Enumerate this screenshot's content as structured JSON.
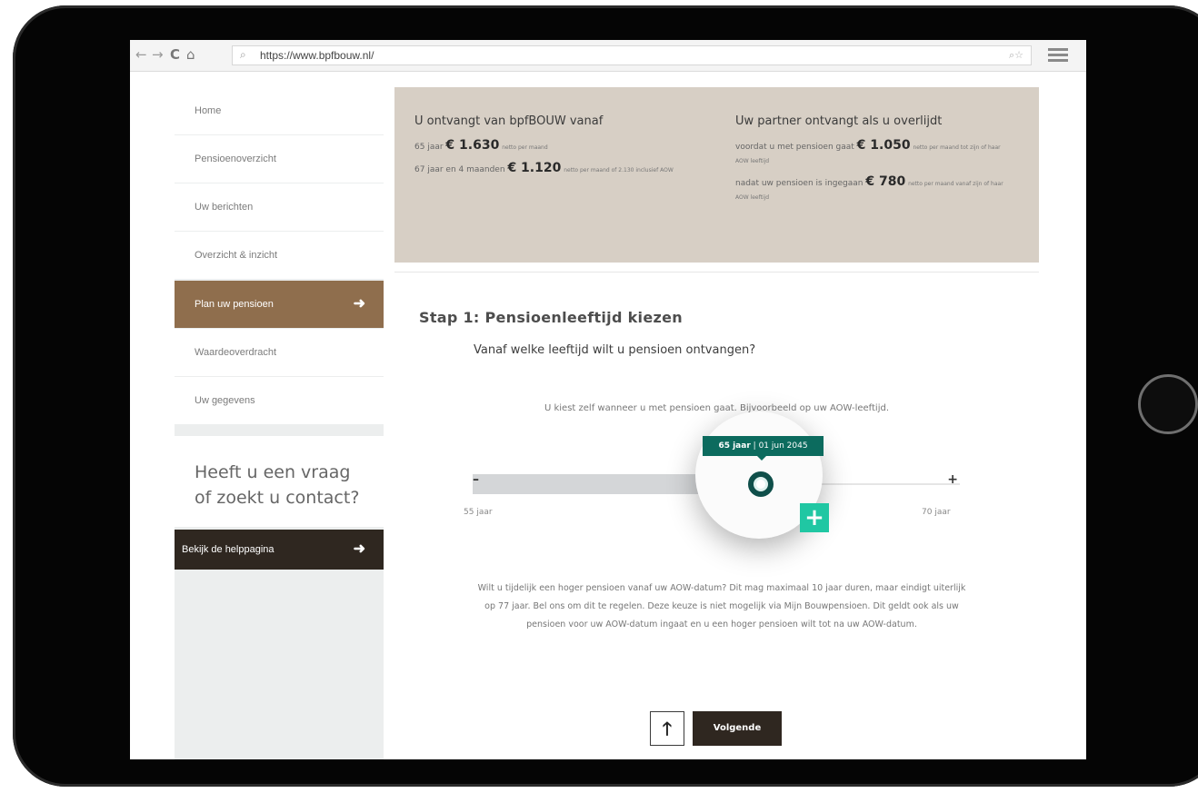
{
  "browser": {
    "back_glyph": "←",
    "forward_glyph": "→",
    "reload_glyph": "C",
    "home_glyph": "⌂",
    "url": "https://www.bpfbouw.nl/",
    "search_glyph": "⌕",
    "right_glyph": "⌕☆"
  },
  "sidebar": {
    "items": [
      {
        "label": "Home"
      },
      {
        "label": "Pensioenoverzicht"
      },
      {
        "label": "Uw berichten"
      },
      {
        "label": "Overzicht & inzicht"
      },
      {
        "label": "Plan uw pensioen",
        "active": true
      },
      {
        "label": "Waardeoverdracht"
      },
      {
        "label": "Uw gegevens"
      }
    ],
    "arrow_glyph": "➜",
    "contact_text": "Heeft u een vraag of zoekt u contact?",
    "help_button": "Bekijk de helppagina"
  },
  "banner": {
    "left": {
      "title": "U ontvangt van bpfBOUW vanaf",
      "line1_prefix": "65 jaar",
      "line1_amount": "€ 1.630",
      "line1_suffix": "netto per maand",
      "line2_prefix": "67 jaar en 4 maanden",
      "line2_amount": "€ 1.120",
      "line2_suffix": "netto per maand of 2.130 inclusief AOW"
    },
    "right": {
      "title": "Uw partner ontvangt als u overlijdt",
      "line1_prefix": "voordat u met pensioen gaat",
      "line1_amount": "€ 1.050",
      "line1_suffix": "netto per maand tot zijn of haar AOW leeftijd",
      "line2_prefix": "nadat uw pensioen is ingegaan",
      "line2_amount": "€ 780",
      "line2_suffix": "netto per maand vanaf zijn of haar AOW leeftijd"
    }
  },
  "main": {
    "step_title": "Stap 1: Pensioenleeftijd kiezen",
    "question": "Vanaf welke leeftijd wilt u pensioen ontvangen?",
    "hint": "U kiest zelf wanneer u met pensioen gaat. Bijvoorbeeld op uw AOW-leeftijd.",
    "slider": {
      "minus": "–",
      "plus": "+",
      "min_label": "55 jaar",
      "max_label": "70 jaar",
      "min_age": 55,
      "max_age": 70,
      "value_age": 65,
      "tooltip_age": "65 jaar",
      "tooltip_sep": "|",
      "tooltip_date": "01 jun 2045",
      "action_plus": "+"
    },
    "paragraph": "Wilt u tijdelijk een hoger pensioen vanaf uw AOW-datum? Dit mag maximaal 10 jaar duren, maar eindigt uiterlijk op 77 jaar. Bel ons om dit te regelen. Deze keuze is niet mogelijk via Mijn Bouwpensioen. Dit geldt ook als uw pensioen voor uw AOW-datum ingaat en u een hoger pensioen wilt tot na uw AOW-datum.",
    "up_glyph": "🡑",
    "next_button": "Volgende"
  },
  "colors": {
    "accent_brown": "#8f6e4d",
    "dark_brown": "#2f2720",
    "banner_bg": "#d7cfc5",
    "teal": "#0c6b5e",
    "mint": "#20c7a3"
  }
}
